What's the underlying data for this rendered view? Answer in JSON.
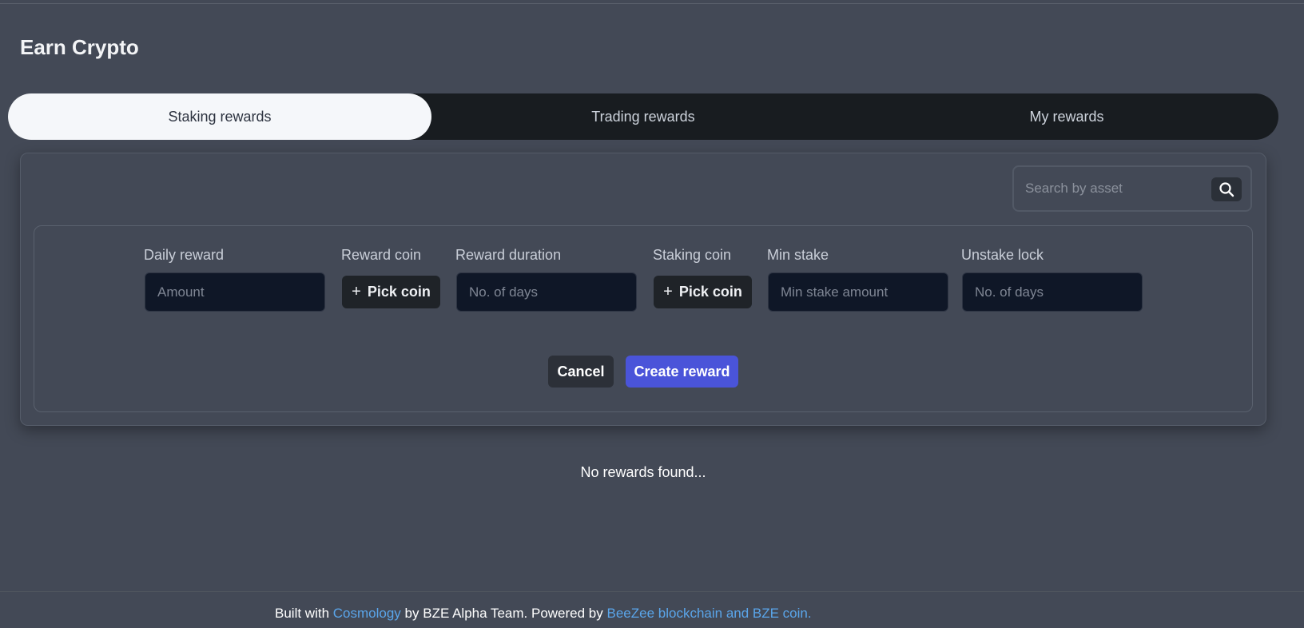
{
  "page": {
    "title": "Earn Crypto"
  },
  "tabs": [
    {
      "label": "Staking rewards",
      "active": true
    },
    {
      "label": "Trading rewards",
      "active": false
    },
    {
      "label": "My rewards",
      "active": false
    }
  ],
  "search": {
    "placeholder": "Search by asset",
    "value": ""
  },
  "form": {
    "daily_reward": {
      "label": "Daily reward",
      "placeholder": "Amount"
    },
    "reward_coin": {
      "label": "Reward coin",
      "button": "Pick coin",
      "icon": "plus-icon"
    },
    "reward_duration": {
      "label": "Reward duration",
      "placeholder": "No. of days"
    },
    "staking_coin": {
      "label": "Staking coin",
      "button": "Pick coin",
      "icon": "plus-icon"
    },
    "min_stake": {
      "label": "Min stake",
      "placeholder": "Min stake amount"
    },
    "unstake_lock": {
      "label": "Unstake lock",
      "placeholder": "No. of days"
    },
    "cancel_label": "Cancel",
    "create_label": "Create reward"
  },
  "empty_message": "No rewards found...",
  "footer": {
    "prefix": "Built with",
    "link1": "Cosmology",
    "middle": "by BZE Alpha Team. Powered by",
    "link2": "BeeZee blockchain and BZE coin."
  },
  "colors": {
    "background": "#434956",
    "tab_bar": "#181c20",
    "tab_active": "#f5f7fa",
    "input_bg": "#0f1727",
    "primary_button": "#4a54d9",
    "link": "#5aa5ea"
  }
}
